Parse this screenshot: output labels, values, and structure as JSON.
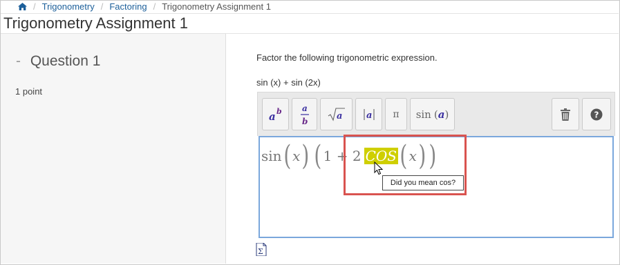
{
  "breadcrumb": {
    "home_icon": "home-icon",
    "items": [
      "Trigonometry",
      "Factoring"
    ],
    "current": "Trigonometry Assignment 1",
    "separator": "/"
  },
  "page": {
    "title": "Trigonometry Assignment 1"
  },
  "question": {
    "dash": "-",
    "title": "Question 1",
    "points": "1 point"
  },
  "main": {
    "prompt": "Factor the following trigonometric expression.",
    "expression": "sin (x) + sin (2x)"
  },
  "toolbar": {
    "buttons": [
      {
        "name": "exponent",
        "icon": "superscript-icon"
      },
      {
        "name": "fraction",
        "icon": "fraction-icon"
      },
      {
        "name": "square-root",
        "icon": "sqrt-icon"
      },
      {
        "name": "absolute-value",
        "icon": "abs-icon"
      },
      {
        "name": "pi",
        "label": "π"
      },
      {
        "name": "sine",
        "label": "sin",
        "arg": "a"
      },
      {
        "name": "delete",
        "icon": "trash-icon"
      },
      {
        "name": "help",
        "icon": "question-icon"
      }
    ]
  },
  "editor": {
    "fn": "sin",
    "var1": "x",
    "inner": "1 + 2",
    "highlighted": "COS",
    "var2": "x"
  },
  "tooltip": {
    "text": "Did you mean cos?"
  },
  "footer": {
    "icon": "sigma-icon"
  },
  "colors": {
    "link": "#1c5f9a",
    "highlight": "#cfcf00",
    "editor_border": "#7aa7dc",
    "annotation_box": "#d9534f",
    "toolbar_icon": "#3a2fa0"
  }
}
